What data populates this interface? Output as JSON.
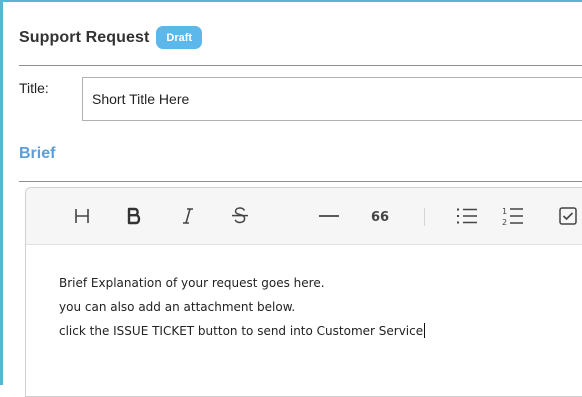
{
  "header": {
    "title": "Support Request",
    "status_badge": "Draft"
  },
  "title_field": {
    "label": "Title:",
    "value": "Short Title Here"
  },
  "brief_section": {
    "label": "Brief"
  },
  "editor": {
    "toolbar": [
      {
        "name": "heading",
        "icon": "heading-icon",
        "glyph": "H"
      },
      {
        "name": "bold",
        "icon": "bold-icon",
        "glyph": "B"
      },
      {
        "name": "italic",
        "icon": "italic-icon",
        "glyph": "I"
      },
      {
        "name": "strikethrough",
        "icon": "strikethrough-icon",
        "glyph": "S"
      },
      {
        "name": "horizontal-rule",
        "icon": "horizontal-rule-icon"
      },
      {
        "name": "quote",
        "icon": "quote-icon",
        "glyph": "66"
      },
      {
        "name": "bulleted-list",
        "icon": "bulleted-list-icon"
      },
      {
        "name": "numbered-list",
        "icon": "numbered-list-icon"
      },
      {
        "name": "task-list",
        "icon": "checkbox-icon"
      }
    ],
    "lines": [
      "Brief Explanation of your request goes here.",
      "you can also add an attachment below.",
      "click the ISSUE TICKET button to send into Customer Service"
    ]
  },
  "colors": {
    "frame_border": "#5bb4d6",
    "badge_bg": "#5cb8ea",
    "section_label": "#5b9fd8"
  }
}
